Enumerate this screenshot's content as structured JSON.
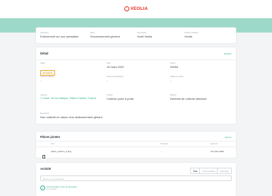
{
  "header": {
    "brand": "VEOLIA",
    "brand_color": "#e1251b",
    "band_color": "#9dd9c8",
    "accent": "#2eae8e"
  },
  "summary": [
    {
      "label": "Prestation",
      "value": "Enlèvement sur une prestation"
    },
    {
      "label": "Motif",
      "value": "Encombrement général"
    },
    {
      "label": "Demandeur",
      "value": "Guell Veolia"
    },
    {
      "label": "Profil du créateur",
      "value": "Veolia"
    }
  ],
  "details": {
    "title": "Détail",
    "edit_label": "Modifier",
    "fields": [
      {
        "label": "Statut",
        "badge": "En attente"
      },
      {
        "label": "Date",
        "value": "15 mars 2022"
      },
      {
        "label": "Heure",
        "value": "09h54"
      },
      {
        "label": "Point de collecte",
        "value": "-"
      },
      {
        "label": "Profil du destinataire",
        "value": "-"
      },
      {
        "label": "Référence client",
        "value": "-"
      },
      {
        "label": "Adresse",
        "value": "7 Chem. de los Martyrs, 33610 Canton, France",
        "link": true
      },
      {
        "label": "Produit",
        "value": "Collecte porte à porte"
      },
      {
        "label": "Matière",
        "value": "Déchets de collecte sélective"
      }
    ],
    "description_label": "Description",
    "description": "Non collecté en raison d'un stationnement gênant"
  },
  "attachments": {
    "title": "Pièces jointes",
    "add_label": "Ajouter",
    "columns": [
      "Nom",
      "Déclarant",
      "Ajouté le"
    ],
    "rows": [
      {
        "name": "photo_camion_3.png",
        "declarant": "-",
        "date": "15 mars 2022"
      }
    ]
  },
  "activity": {
    "title": "Activité",
    "tabs": [
      "Tout",
      "Commentaires",
      "Historique"
    ],
    "comment_placeholder": "Écrire un commentaire...",
    "event": "Guell Veolia a créé la demande.",
    "event_time": "Il y a 2 jours"
  }
}
